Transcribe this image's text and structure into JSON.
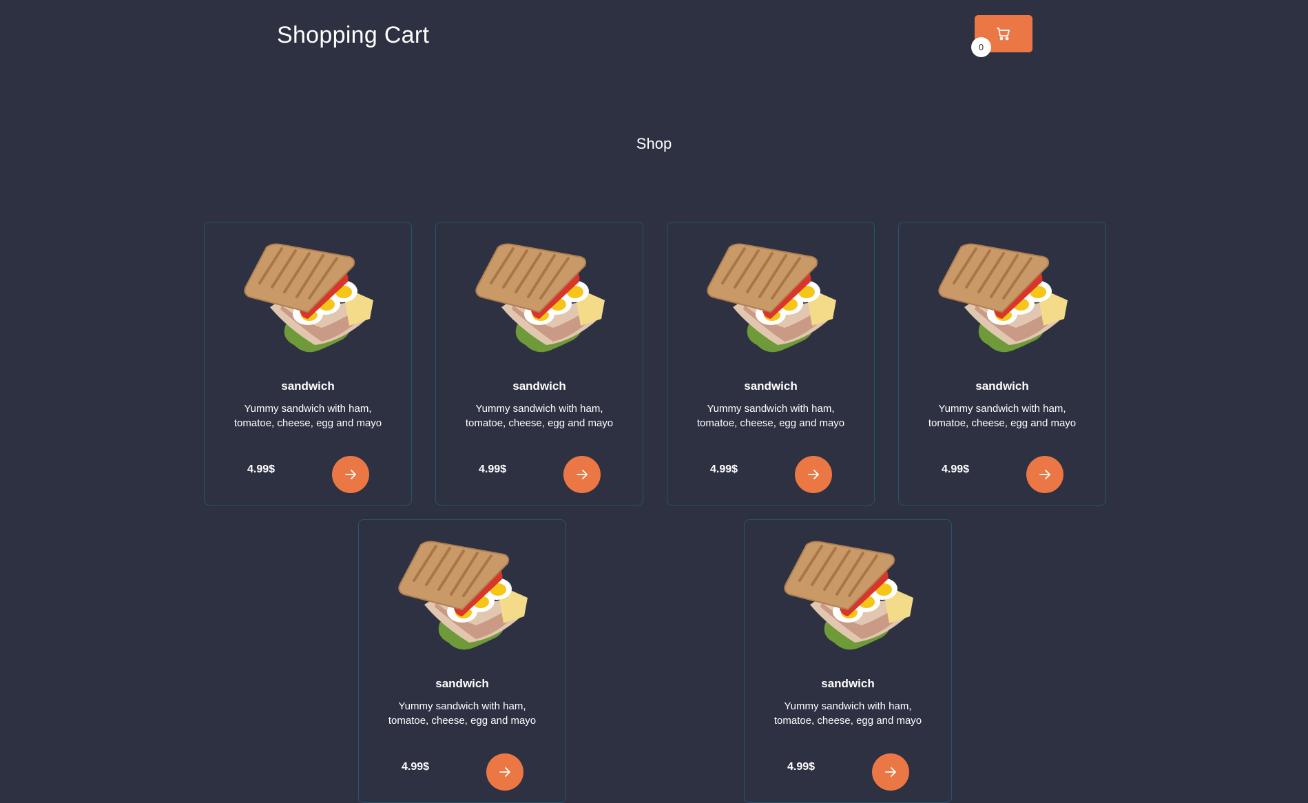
{
  "header": {
    "title": "Shopping Cart",
    "cart_count": "0"
  },
  "shop": {
    "title": "Shop"
  },
  "products": [
    {
      "name": "sandwich",
      "description": "Yummy sandwich with ham, tomatoe, cheese, egg and mayo",
      "price": "4.99$"
    },
    {
      "name": "sandwich",
      "description": "Yummy sandwich with ham, tomatoe, cheese, egg and mayo",
      "price": "4.99$"
    },
    {
      "name": "sandwich",
      "description": "Yummy sandwich with ham, tomatoe, cheese, egg and mayo",
      "price": "4.99$"
    },
    {
      "name": "sandwich",
      "description": "Yummy sandwich with ham, tomatoe, cheese, egg and mayo",
      "price": "4.99$"
    },
    {
      "name": "sandwich",
      "description": "Yummy sandwich with ham, tomatoe, cheese, egg and mayo",
      "price": "4.99$"
    },
    {
      "name": "sandwich",
      "description": "Yummy sandwich with ham, tomatoe, cheese, egg and mayo",
      "price": "4.99$"
    }
  ],
  "colors": {
    "background": "#2e3142",
    "accent": "#eb7745",
    "card_border": "#24566a"
  },
  "icons": {
    "cart": "shopping-cart-icon",
    "add": "arrow-right-icon"
  }
}
